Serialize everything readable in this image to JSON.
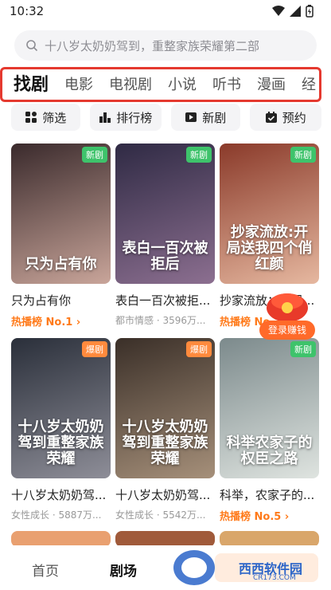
{
  "status": {
    "time": "10:32"
  },
  "search": {
    "placeholder": "十八岁太奶奶驾到，重整家族荣耀第二部"
  },
  "tabs": [
    {
      "label": "找剧"
    },
    {
      "label": "电影"
    },
    {
      "label": "电视剧"
    },
    {
      "label": "小说"
    },
    {
      "label": "听书"
    },
    {
      "label": "漫画"
    },
    {
      "label": "经"
    }
  ],
  "filters": [
    {
      "label": "筛选",
      "icon": "grid-icon"
    },
    {
      "label": "排行榜",
      "icon": "bar-chart-icon"
    },
    {
      "label": "新剧",
      "icon": "play-icon"
    },
    {
      "label": "预约",
      "icon": "calendar-check-icon"
    }
  ],
  "cards": [
    {
      "title": "只为占有你",
      "poster_text": "只为占有你",
      "badge": "新剧",
      "badge_type": "new",
      "meta": "热播榜 No.1 ›",
      "meta_type": "rank",
      "colors": [
        "#3a2a2c",
        "#c9a59a"
      ]
    },
    {
      "title": "表白一百次被拒...",
      "poster_text": "表白一百次被拒后",
      "badge": "新剧",
      "badge_type": "new",
      "meta": "都市情感 · 3596万...",
      "meta_type": "plain",
      "colors": [
        "#2f2a44",
        "#8c6f90"
      ]
    },
    {
      "title": "抄家流放：开局...",
      "poster_text": "抄家流放:开局送我四个俏红颜",
      "badge": "新剧",
      "badge_type": "new",
      "meta": "热播榜 No.2 ›",
      "meta_type": "rank",
      "colors": [
        "#8a3a2a",
        "#e6b8a0"
      ]
    },
    {
      "title": "十八岁太奶奶驾...",
      "poster_text": "十八岁太奶奶驾到重整家族荣耀",
      "badge": "爆剧",
      "badge_type": "hot",
      "meta": "女性成长 · 5887万...",
      "meta_type": "plain",
      "colors": [
        "#2a2f3a",
        "#8e8e98"
      ]
    },
    {
      "title": "十八岁太奶奶驾...",
      "poster_text": "十八岁太奶奶驾到重整家族荣耀",
      "badge": "爆剧",
      "badge_type": "hot",
      "meta": "女性成长 · 5542万...",
      "meta_type": "plain",
      "colors": [
        "#3a2f28",
        "#a6907a"
      ]
    },
    {
      "title": "科举，农家子的...",
      "poster_text": "科举农家子的权臣之路",
      "badge": "新剧",
      "badge_type": "new",
      "meta": "热播榜 No.5 ›",
      "meta_type": "rank",
      "colors": [
        "#7c8a8c",
        "#dfe4e0"
      ]
    }
  ],
  "floating": {
    "login_label": "登录赚钱"
  },
  "bottom_nav": [
    {
      "label": "首页"
    },
    {
      "label": "剧场"
    }
  ],
  "watermark": {
    "text": "西西软件园",
    "sub": "CR173.COM"
  }
}
